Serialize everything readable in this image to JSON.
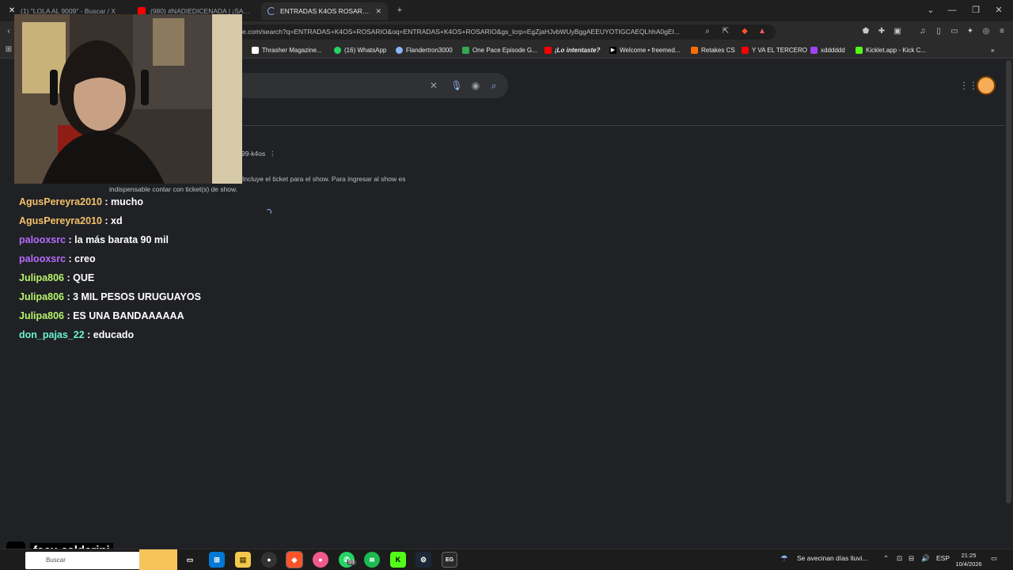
{
  "tabs": [
    {
      "label": "(1) \"LOLA AL 9009\" - Buscar / X",
      "active": false,
      "favicon_color": "#000000",
      "icon": "x-icon"
    },
    {
      "label": "(980) #NADIEDICENADA | ¡SANTI PR...",
      "active": false,
      "favicon_color": "#ff0000",
      "icon": "youtube-icon"
    },
    {
      "label": "ENTRADAS K4OS ROSARIO - Bu...",
      "active": true,
      "favicon_color": "#8ab4f8",
      "icon": "loading-icon"
    }
  ],
  "window_controls": {
    "minimize": "—",
    "maximize": "❐",
    "close": "✕",
    "dropdown": "⌄",
    "new_tab": "+"
  },
  "address_bar": {
    "url": "e.com/search?q=ENTRADAS+K4OS+ROSARIO&oq=ENTRADAS+K4OS+ROSARIO&gs_lcrp=EgZjaHJvbWUyBggAEEUYOTIGCAEQLhhA0gEI..."
  },
  "bookmarks": [
    {
      "label": "Thrasher Magazine...",
      "color": "#ffffff"
    },
    {
      "label": "(16) WhatsApp",
      "color": "#25d366"
    },
    {
      "label": "Flandertron3000",
      "color": "#8ab4f8"
    },
    {
      "label": "One Pace Episode G...",
      "color": "#34a853"
    },
    {
      "label": "¡Lo intentaste?",
      "color": "#ff0000"
    },
    {
      "label": "Welcome • freemed...",
      "color": "#000000"
    },
    {
      "label": "Retakes CS",
      "color": "#ff6d00"
    },
    {
      "label": "Y VA EL TERCERO",
      "color": "#ff0000"
    },
    {
      "label": "xdddddd",
      "color": "#a142f4"
    },
    {
      "label": "Kicklet.app - Kick C...",
      "color": "#53fc18"
    }
  ],
  "results": {
    "breadcrumb": "99-k4os",
    "snippet_line1": "Incluye el ticket para el show. Para ingresar al show es",
    "snippet_line2": "indispensable contar con ticket(s) de show."
  },
  "chat": [
    {
      "user": "AgusPereyra2010",
      "color": "#f5c16c",
      "text": "mucho"
    },
    {
      "user": "AgusPereyra2010",
      "color": "#f5c16c",
      "text": "xd"
    },
    {
      "user": "palooxsrc",
      "color": "#b36bff",
      "text": "la más barata 90 mil"
    },
    {
      "user": "palooxsrc",
      "color": "#b36bff",
      "text": "creo"
    },
    {
      "user": "Julipa806",
      "color": "#b6f36b",
      "text": "QUE"
    },
    {
      "user": "Julipa806",
      "color": "#b6f36b",
      "text": "3 MIL PESOS URUGUAYOS"
    },
    {
      "user": "Julipa806",
      "color": "#b6f36b",
      "text": "ES UNA BANDAAAAAA"
    },
    {
      "user": "don_pajas_22",
      "color": "#6bf3d2",
      "text": "educado"
    }
  ],
  "overlay": {
    "tiktok_handle": "facu.calderini",
    "search_placeholder": "Buscar"
  },
  "taskbar": {
    "whatsapp_badge": "93",
    "weather": "Se avecinan días lluvi...",
    "language": "ESP",
    "time": "21:25",
    "date": "10/4/2026"
  }
}
